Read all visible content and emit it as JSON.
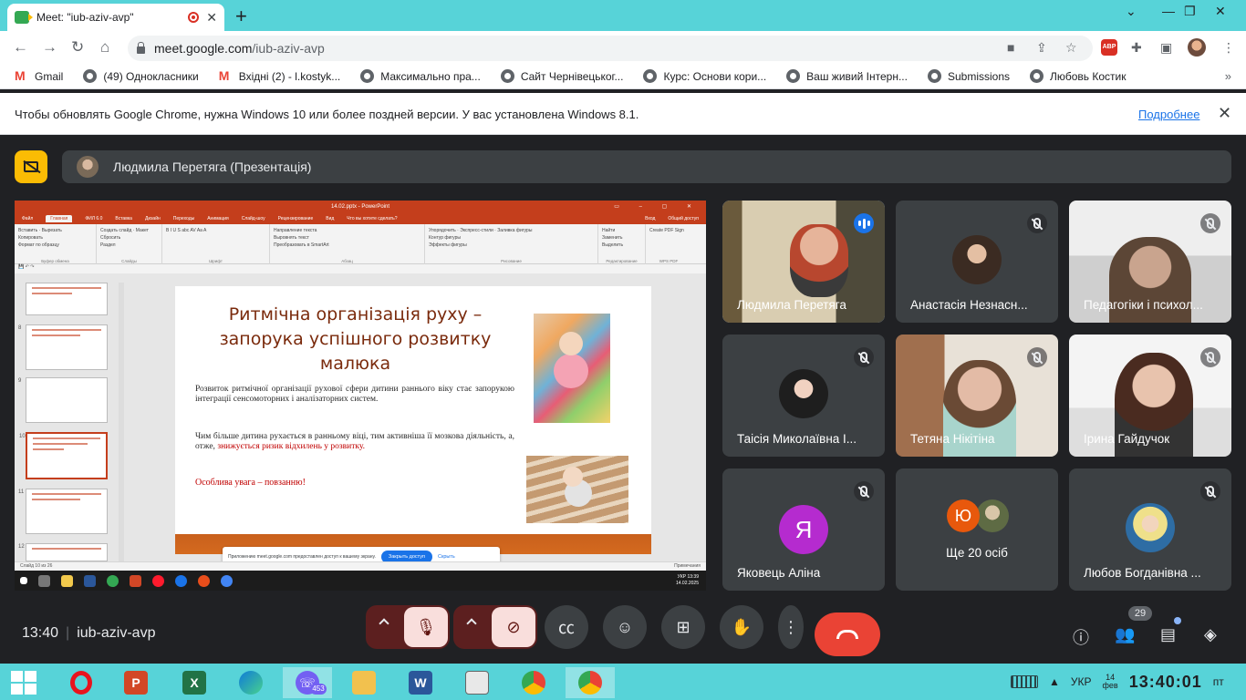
{
  "browser": {
    "tab_title": "Meet: \"iub-aziv-avp\"",
    "url_host": "meet.google.com",
    "url_path": "/iub-aziv-avp",
    "bookmarks": [
      {
        "label": "Gmail",
        "icon": "gmail-icon"
      },
      {
        "label": "(49) Однокласники",
        "icon": "globe-icon"
      },
      {
        "label": "Вхідні (2) - l.kostyk...",
        "icon": "gmail-icon"
      },
      {
        "label": "Максимально пра...",
        "icon": "globe-icon"
      },
      {
        "label": "Сайт Чернівецьког...",
        "icon": "globe-icon"
      },
      {
        "label": "Курс: Основи кори...",
        "icon": "globe-icon"
      },
      {
        "label": "Ваш живий Інтерн...",
        "icon": "globe-icon"
      },
      {
        "label": "Submissions",
        "icon": "globe-icon"
      },
      {
        "label": "Любовь Костик",
        "icon": "globe-icon"
      }
    ],
    "infobar_message": "Чтобы обновлять Google Chrome, нужна Windows 10 или более поздней версии. У вас установлена Windows 8.1.",
    "infobar_link": "Подробнее",
    "abp_label": "ABP"
  },
  "meet": {
    "presenter_label": "Людмила Перетяга (Презентація)",
    "meeting_time": "13:40",
    "meeting_code": "iub-aziv-avp",
    "people_count": "29",
    "participants": [
      {
        "name": "Людмила Перетяга",
        "mic": "active"
      },
      {
        "name": "Анастасія Незнасн...",
        "mic": "muted"
      },
      {
        "name": "Педагогіки і психол...",
        "mic": "muted"
      },
      {
        "name": "Таісія Миколаївна І...",
        "mic": "muted"
      },
      {
        "name": "Тетяна Нікітіна",
        "mic": "muted"
      },
      {
        "name": "Ірина Гайдучок",
        "mic": "muted"
      },
      {
        "name": "Яковець Аліна",
        "mic": "muted",
        "initial": "Я"
      },
      {
        "name": "Ще 20 осіб",
        "initial": "Ю"
      },
      {
        "name": "Любов Богданівна ...",
        "mic": "muted"
      }
    ],
    "colors": {
      "accent": "#8ab4f8",
      "end_call": "#ea4335",
      "avatar_purple": "#b52bcf",
      "avatar_orange": "#e8580c"
    }
  },
  "presentation": {
    "window_title": "14.02.pptx - PowerPoint",
    "ribbon_tabs": [
      "Файл",
      "Главная",
      "ФИЛ 6.0",
      "Вставка",
      "Дизайн",
      "Переходы",
      "Анимация",
      "Слайд-шоу",
      "Рецензирование",
      "Вид",
      "Что вы хотите сделать?",
      "Вход",
      "Общий доступ"
    ],
    "ribbon_groups": [
      {
        "label": "Буфер обмена",
        "items": [
          "Вставить",
          "Вырезать",
          "Копировать",
          "Формат по образцу"
        ]
      },
      {
        "label": "Слайды",
        "items": [
          "Создать слайд",
          "Макет",
          "Сбросить",
          "Раздел"
        ]
      },
      {
        "label": "Шрифт",
        "items": []
      },
      {
        "label": "Абзац",
        "items": [
          "Направление текста",
          "Выровнять текст",
          "Преобразовать в SmartArt"
        ]
      },
      {
        "label": "Рисование",
        "items": [
          "Упорядочить",
          "Экспресс-стили",
          "Заливка фигуры",
          "Контур фигуры",
          "Эффекты фигуры"
        ]
      },
      {
        "label": "Редактирование",
        "items": [
          "Найти",
          "Заменить",
          "Выделить"
        ]
      },
      {
        "label": "WPS PDF",
        "items": [
          "Create PDF",
          "Sign"
        ]
      }
    ],
    "thumb_numbers": [
      "8",
      "9",
      "10",
      "11",
      "12"
    ],
    "slide": {
      "title": "Ритмічна організація руху – запорука успішного розвитку малюка",
      "paragraph1": "Розвиток ритмічної організації рухової сфери дитини раннього віку стає запорукою інтеграції сенсомоторних і аналізаторних систем.",
      "paragraph2_a": "Чим більше дитина рухається в ранньому віці, тим активніша її мозкова діяльність, а, отже,",
      "paragraph2_b": "знижується ризик відхилень у розвитку.",
      "paragraph3": "Особлива увага – повзанню!"
    },
    "status_left": "Слайд 10 из 26",
    "status_right": "Примечания",
    "share_notice": "Приложению meet.google.com предоставлен доступ к вашему экрану.",
    "share_stop": "Закрыть доступ",
    "share_hide": "Скрыть",
    "inner_clock_time": "13:39",
    "inner_clock_date": "14.02.2025",
    "inner_lang": "УКР"
  },
  "taskbar": {
    "viber_badge": "453",
    "lang": "УКР",
    "date_day": "14",
    "date_month": "фев",
    "weekday": "пт",
    "time": "13:40:01"
  }
}
